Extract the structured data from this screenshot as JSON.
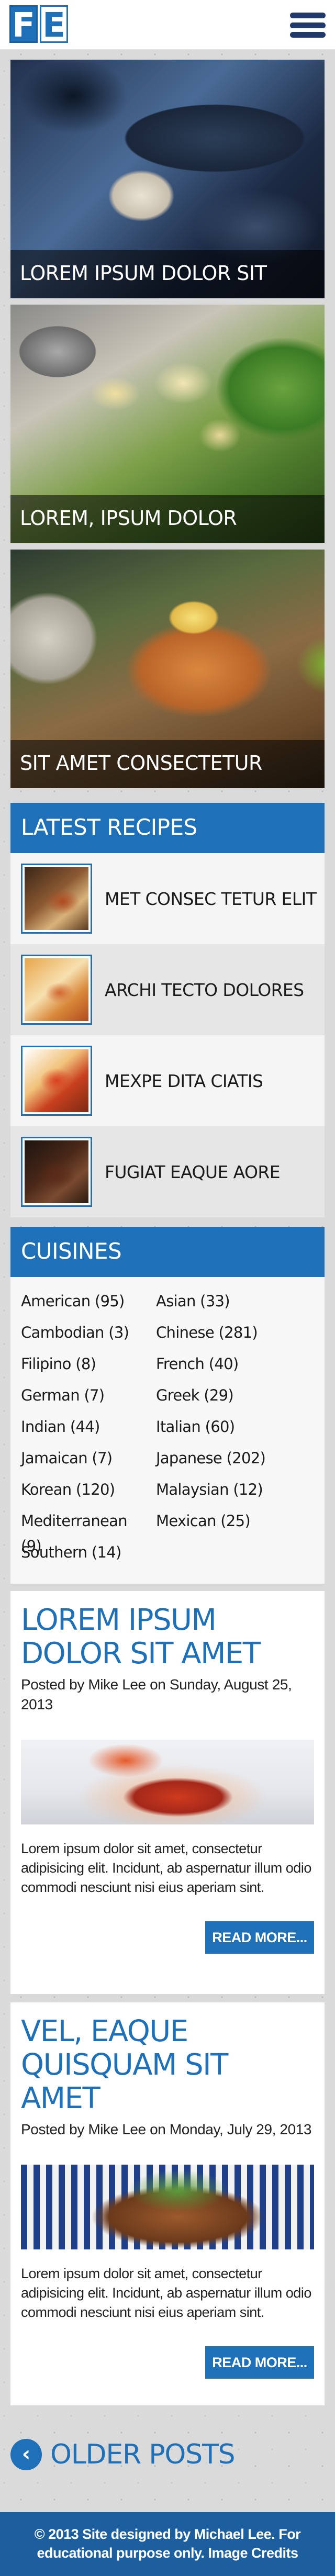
{
  "header": {
    "logo_letters": [
      "F",
      "E"
    ],
    "menu_icon": "hamburger-menu-icon"
  },
  "hero": [
    {
      "caption": "LOREM IPSUM DOLOR SIT"
    },
    {
      "caption": "LOREM, IPSUM DOLOR"
    },
    {
      "caption": "SIT AMET CONSECTETUR"
    }
  ],
  "latest_recipes": {
    "title": "LATEST RECIPES",
    "items": [
      {
        "label": "MET CONSEC TETUR ELIT"
      },
      {
        "label": "ARCHI TECTO DOLORES"
      },
      {
        "label": "MEXPE DITA CIATIS"
      },
      {
        "label": "FUGIAT EAQUE AORE"
      }
    ]
  },
  "cuisines": {
    "title": "CUISINES",
    "items": [
      "American (95)",
      "Asian (33)",
      "Cambodian (3)",
      "Chinese (281)",
      "Filipino (8)",
      "French (40)",
      "German (7)",
      "Greek (29)",
      "Indian (44)",
      "Italian (60)",
      "Jamaican (7)",
      "Japanese (202)",
      "Korean (120)",
      "Malaysian (12)",
      "Mediterranean (9)",
      "Mexican (25)",
      "Southern (14)"
    ]
  },
  "posts": [
    {
      "title": "LOREM IPSUM DOLOR SIT AMET",
      "meta_prefix": "Posted by ",
      "author": "Mike Lee",
      "meta_mid": " on ",
      "date": "Sunday, August 25, 2013",
      "body": "Lorem ipsum dolor sit amet, consectetur adipisicing elit. Incidunt, ab aspernatur illum odio commodi nesciunt nisi eius aperiam sint.",
      "read_more": "READ MORE..."
    },
    {
      "title": "VEL, EAQUE QUISQUAM SIT AMET",
      "meta_prefix": "Posted by ",
      "author": "Mike Lee",
      "meta_mid": " on ",
      "date": "Monday, July 29, 2013",
      "body": "Lorem ipsum dolor sit amet, consectetur adipisicing elit. Incidunt, ab aspernatur illum odio commodi nesciunt nisi eius aperiam sint.",
      "read_more": "READ MORE..."
    }
  ],
  "older_posts": {
    "label": "OLDER POSTS",
    "icon": "chevron-left-icon",
    "glyph": "‹"
  },
  "footer": {
    "text_prefix": "© 2013 Site designed by ",
    "designer": "Michael Lee",
    "text_mid": ". For educational purpose only. ",
    "credits_link": "Image Credits"
  },
  "colors": {
    "brand_blue": "#1e70b8",
    "footer_blue": "#1d5f9e",
    "page_background": "#dadada"
  }
}
